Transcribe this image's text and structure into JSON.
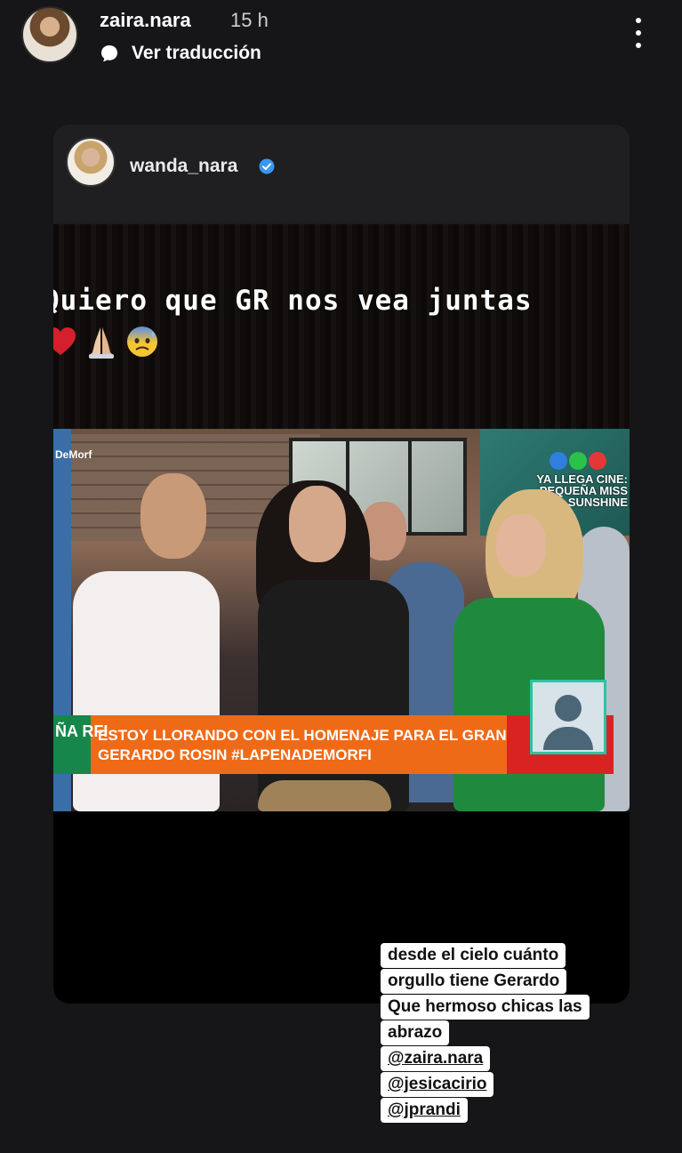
{
  "story_header": {
    "username": "zaira.nara",
    "time": "15 h",
    "translate_label": "Ver traducción"
  },
  "repost": {
    "username": "wanda_nara",
    "quote_text": "Quiero que GR nos vea juntas",
    "emojis": [
      "red-heart",
      "folded-hands",
      "anxious-face-with-sweat"
    ],
    "tv": {
      "channel_tag": "DeMorf",
      "promo_text": "YA LLEGA CINE: PEQUEÑA MISS SUNSHINE",
      "ticker_left": "ÑA RFI",
      "ticker_text": "ESTOY LLORANDO CON EL HOMENAJE PARA EL GRAN GERARDO ROSIN #LAPENADEMORFI",
      "logo_colors": [
        "#2f7ee0",
        "#2bc24a",
        "#e23838"
      ]
    }
  },
  "caption": {
    "lines": [
      "desde el cielo cuánto",
      "orgullo tiene Gerardo",
      "Que hermoso chicas las",
      "abrazo"
    ],
    "mentions": [
      "@zaira.nara",
      "@jesicacirio",
      "@jprandi"
    ]
  },
  "colors": {
    "background": "#161618",
    "verified": "#3897f0",
    "ticker_orange": "#ef6a17",
    "ticker_green": "#16864a"
  }
}
